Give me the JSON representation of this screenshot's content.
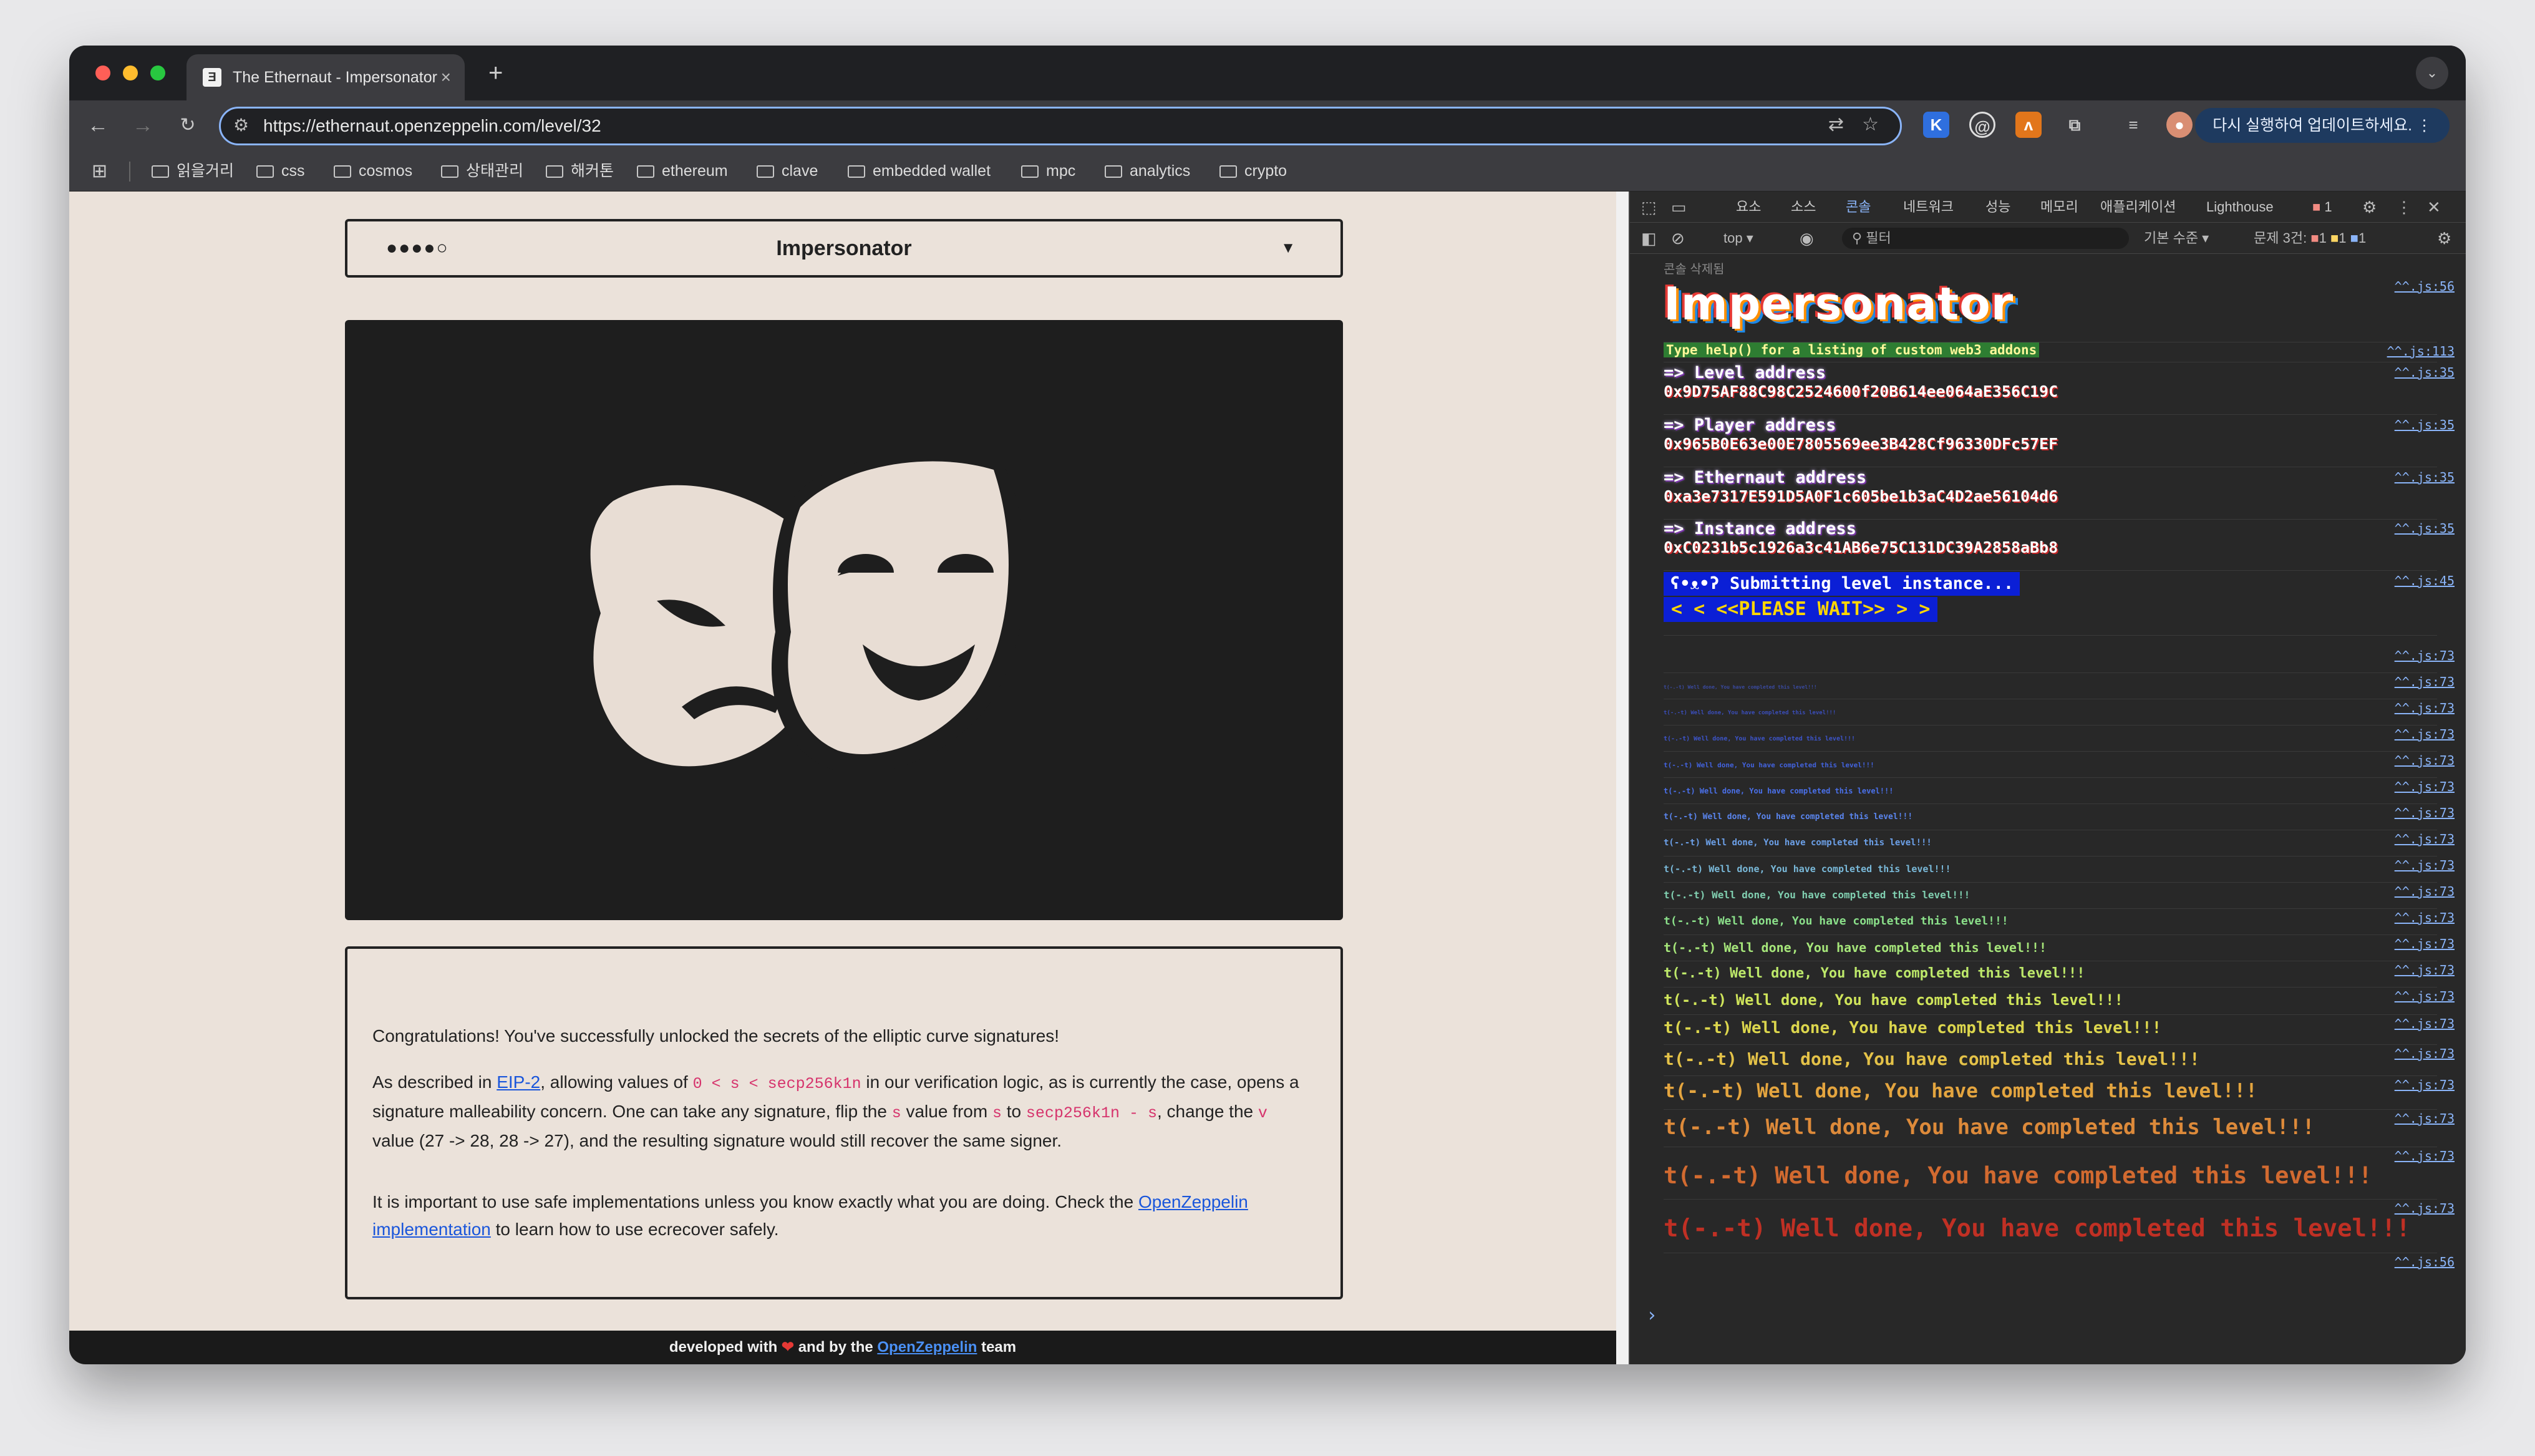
{
  "browser": {
    "tab_title": "The Ethernaut - Impersonator",
    "tab_favicon": "Ǝ",
    "url": "https://ethernaut.openzeppelin.com/level/32",
    "update_button": "다시 실행하여 업데이트하세요.",
    "bookmarks": [
      "읽을거리",
      "css",
      "cosmos",
      "상태관리",
      "해커톤",
      "ethereum",
      "clave",
      "embedded wallet",
      "mpc",
      "analytics",
      "crypto"
    ]
  },
  "page": {
    "level_dots": "●●●●○",
    "level_title": "Impersonator",
    "congrats": "Congratulations! You've successfully unlocked the secrets of the elliptic curve signatures!",
    "p2_a": "As described in ",
    "p2_link": "EIP-2",
    "p2_b": ", allowing values of ",
    "p2_code1": "0 < s < secp256k1n",
    "p2_c": " in our verification logic, as is currently the case, opens a signature malleability concern. One can take any signature, flip the ",
    "p2_code2": "s",
    "p2_d": " value from ",
    "p2_code3": "s",
    "p2_e": " to ",
    "p2_code4": "secp256k1n - s",
    "p2_f": ", change the ",
    "p2_code5": "v",
    "p2_g": " value (27 -> 28, 28 -> 27), and the resulting signature would still recover the same signer.",
    "p3_a": "It is important to use safe implementations unless you know exactly what you are doing. Check the ",
    "p3_link": "OpenZeppelin implementation",
    "p3_b": " to learn how to use ecrecover safely.",
    "footer_a": "developed with ",
    "footer_b": " and  by the ",
    "footer_link": "OpenZeppelin",
    "footer_c": " team"
  },
  "devtools": {
    "tabs": [
      "요소",
      "소스",
      "콘솔",
      "네트워크",
      "성능",
      "메모리",
      "애플리케이션",
      "Lighthouse"
    ],
    "active_tab": "콘솔",
    "error_count": "1",
    "context": "top ▾",
    "filter_placeholder": "필터",
    "level_select": "기본 수준 ▾",
    "issues_label": "문제 3건:",
    "issues": [
      "1",
      "1",
      "1"
    ],
    "cleared": "콘솔 삭제됨",
    "banner": "Impersonator",
    "help": "Type help() for a listing of custom web3 addons",
    "entries": [
      {
        "key": "=> Level address",
        "value": "0x9D75AF88C98C2524600f20B614ee064aE356C19C"
      },
      {
        "key": "=> Player address",
        "value": "0x965B0E63e00E7805569ee3B428Cf96330DFc57EF"
      },
      {
        "key": "=> Ethernaut address",
        "value": "0xa3e7317E591D5A0F1c605be1b3aC4D2ae56104d6"
      },
      {
        "key": "=> Instance address",
        "value": "0xC0231b5c1926a3c41AB6e75C131DC39A2858aBb8"
      }
    ],
    "submitting": "ʕ•ᴥ•ʔ Submitting level instance...",
    "please_wait": "< < <<PLEASE WAIT>> > >",
    "well_done": "t(-.-t) Well done, You have completed this level!!!",
    "sources": {
      "s56": "^^.js:56",
      "s113": "^^.js:113",
      "s35": "^^.js:35",
      "s45": "^^.js:45",
      "s73": "^^.js:73"
    }
  },
  "colors": {
    "accent": "#8ab4f8",
    "page_bg": "#ebe2da",
    "hero_bg": "#1e1e1e"
  }
}
